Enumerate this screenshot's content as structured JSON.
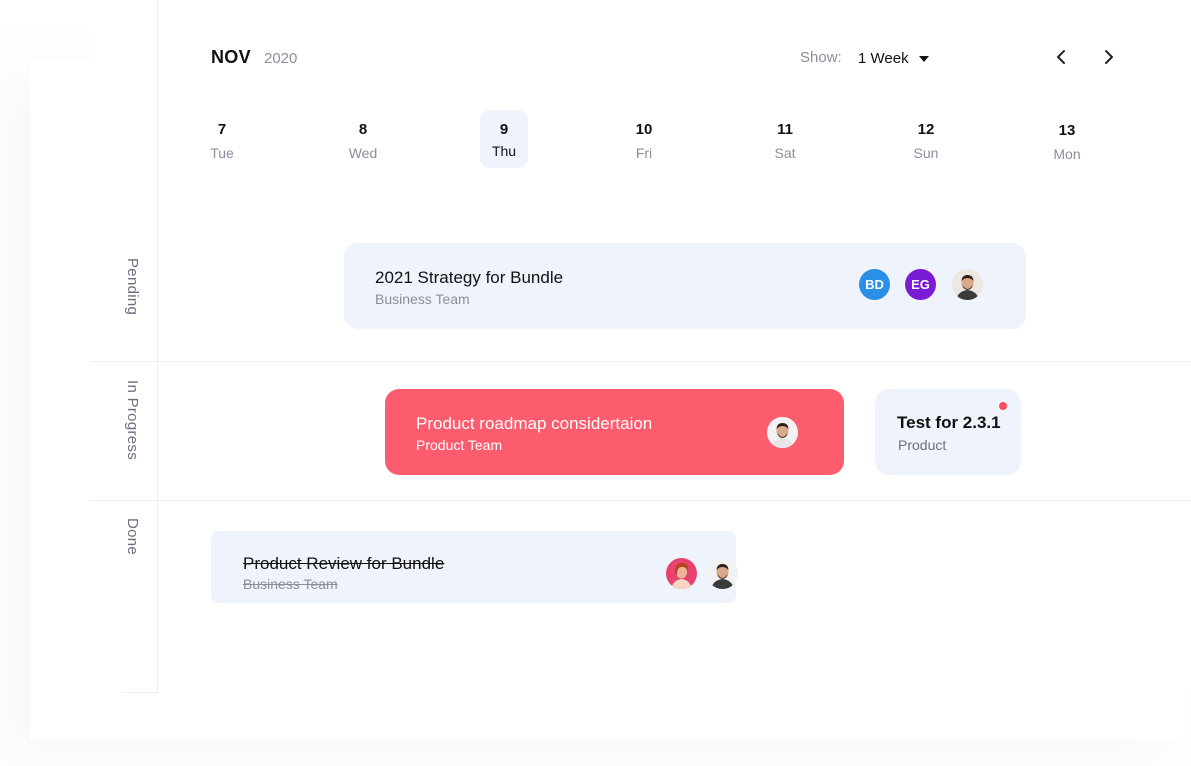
{
  "header": {
    "month": "NOV",
    "year": "2020",
    "show_label": "Show:",
    "show_value": "1 Week",
    "prev_icon": "chevron-left-icon",
    "next_icon": "chevron-right-icon"
  },
  "days": [
    {
      "num": "7",
      "name": "Tue",
      "active": false
    },
    {
      "num": "8",
      "name": "Wed",
      "active": false
    },
    {
      "num": "9",
      "name": "Thu",
      "active": true
    },
    {
      "num": "10",
      "name": "Fri",
      "active": false
    },
    {
      "num": "11",
      "name": "Sat",
      "active": false
    },
    {
      "num": "12",
      "name": "Sun",
      "active": false
    },
    {
      "num": "13",
      "name": "Mon",
      "active": false
    }
  ],
  "lanes": {
    "pending": "Pending",
    "in_progress": "In Progress",
    "done": "Done"
  },
  "cards": {
    "strategy": {
      "title": "2021 Strategy for Bundle",
      "subtitle": "Business Team",
      "avatars": [
        "BD",
        "EG"
      ]
    },
    "roadmap": {
      "title": "Product roadmap considertaion",
      "subtitle": "Product Team"
    },
    "test": {
      "title": "Test for 2.3.1",
      "subtitle": "Product"
    },
    "review": {
      "title": "Product Review for Bundle",
      "subtitle": "Business Team"
    }
  },
  "colors": {
    "accent_red": "#fd5c6f",
    "card_bg": "#eef3fc",
    "avatar_bd": "#2a8fe6",
    "avatar_eg": "#7a1cd6",
    "notification_dot": "#ff4d5e"
  }
}
